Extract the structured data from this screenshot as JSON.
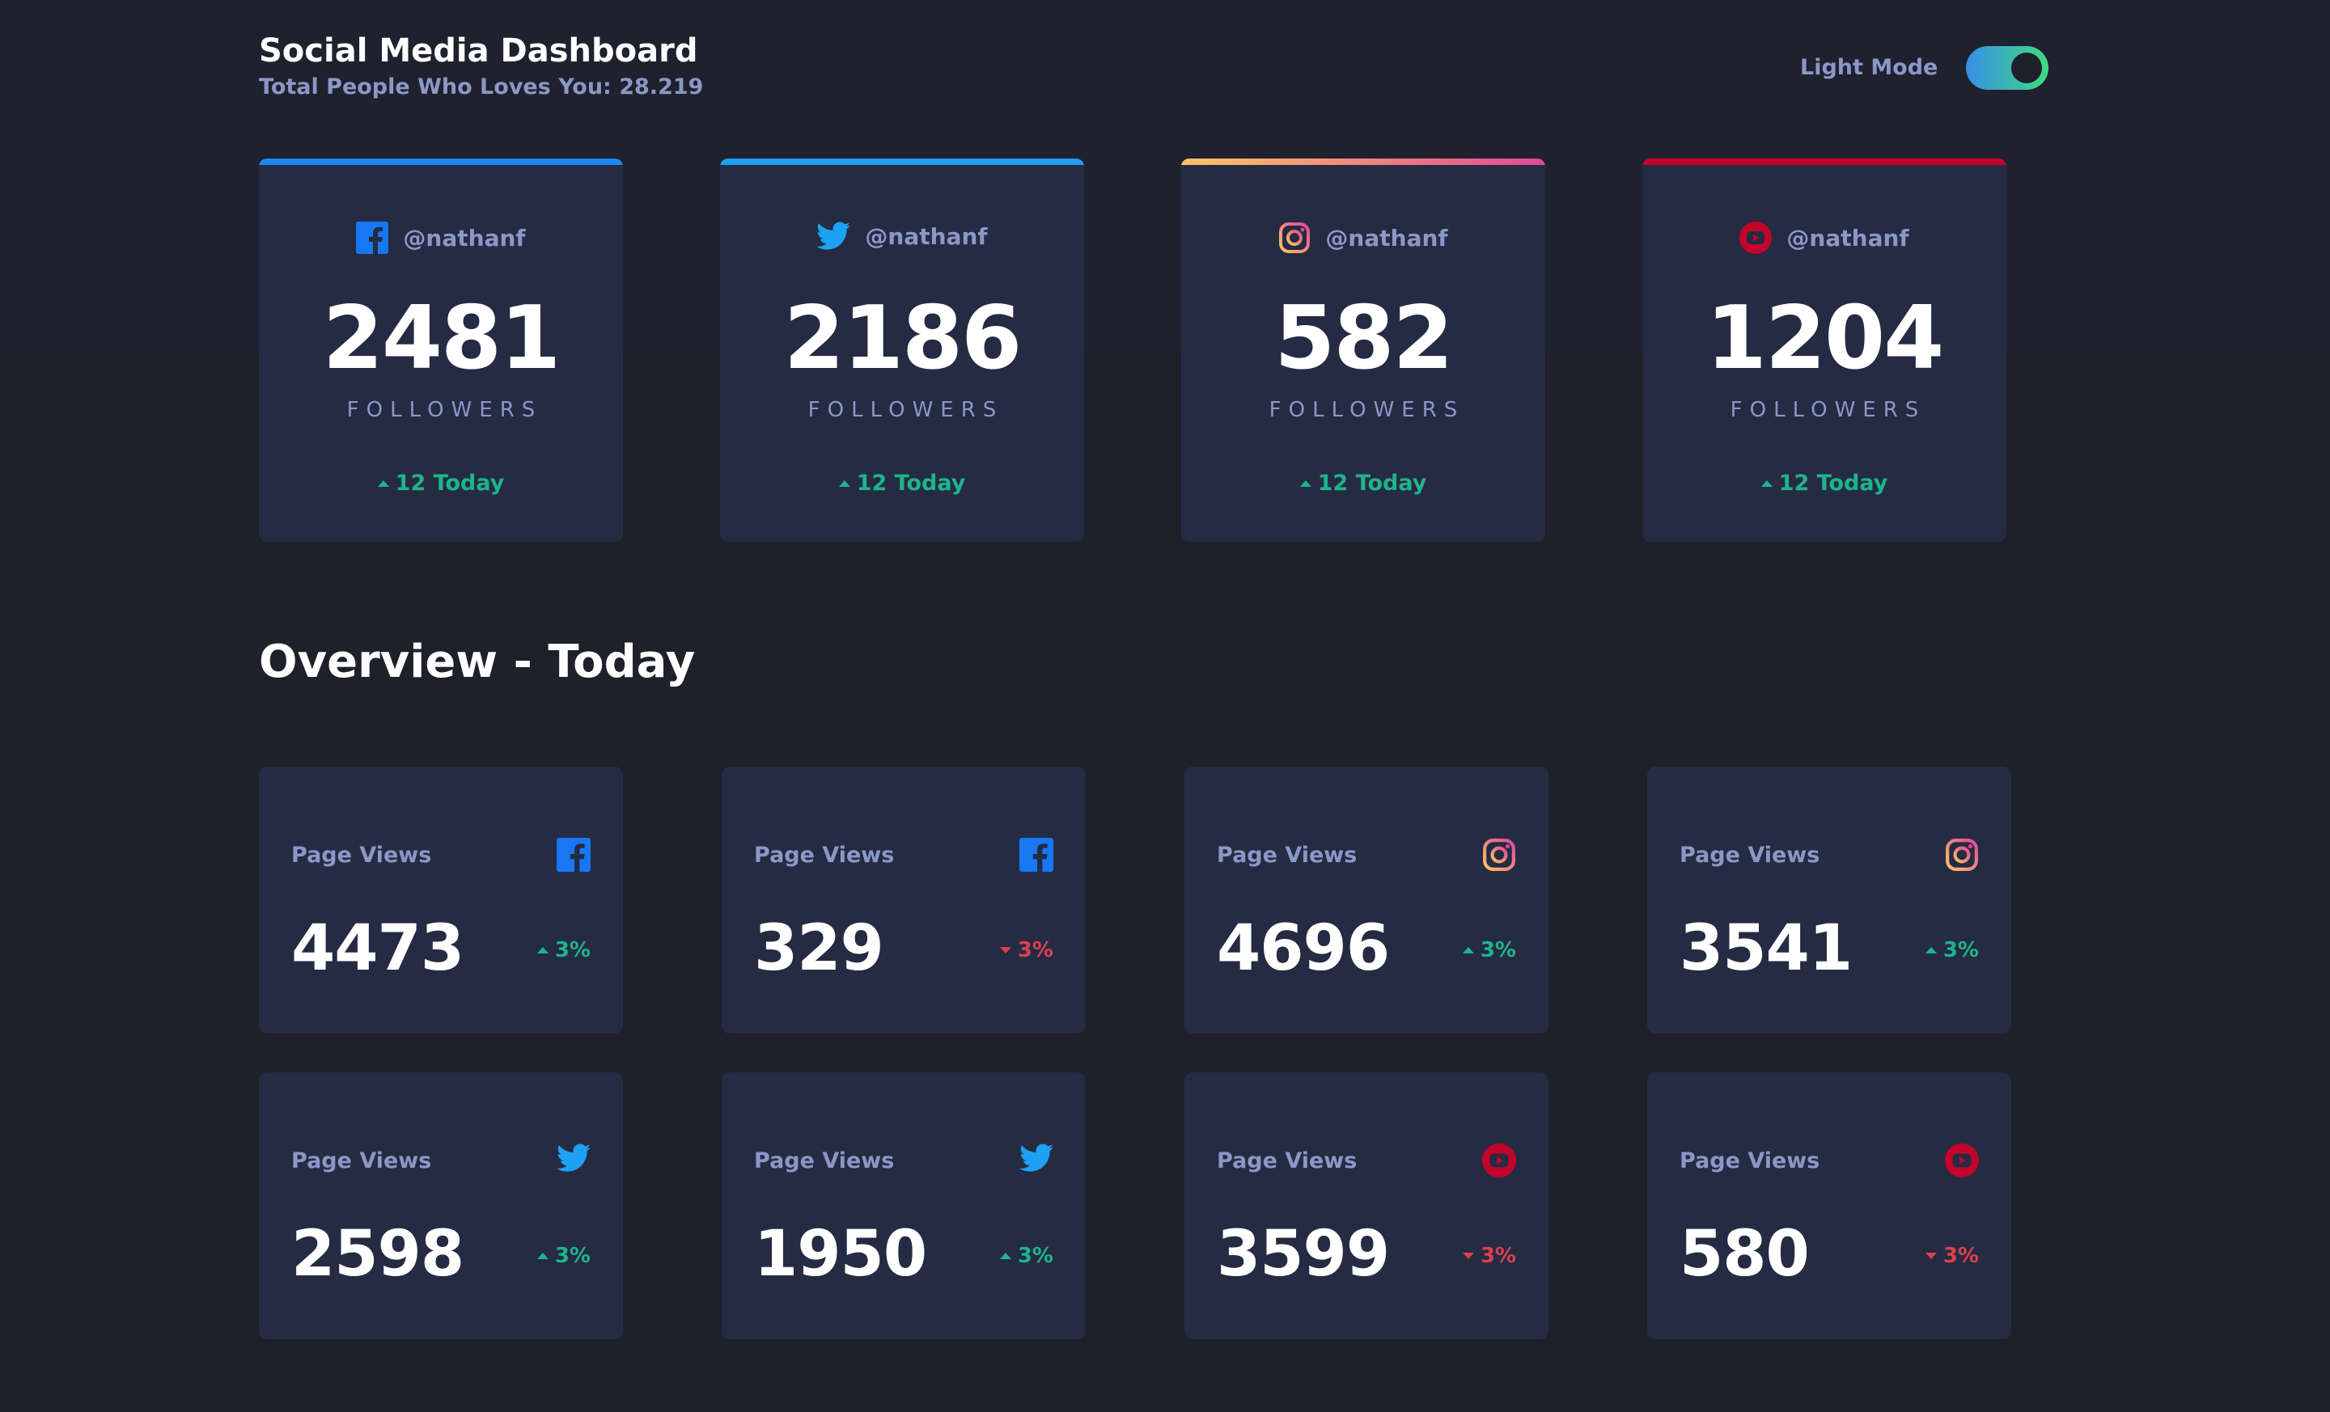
{
  "header": {
    "title": "Social Media Dashboard",
    "subtitle": "Total People Who Loves You: 28.219",
    "mode_label": "Light Mode"
  },
  "colors": {
    "facebook": "#1877f2",
    "twitter": "#1da1f2",
    "instagram": "#f37b6b",
    "youtube": "#c4032a",
    "positive": "#1db489",
    "negative": "#dc414c"
  },
  "followers": [
    {
      "platform": "facebook",
      "icon": "facebook-icon",
      "handle": "@nathanf",
      "count": "2481",
      "label": "FOLLOWERS",
      "today": "12 Today"
    },
    {
      "platform": "twitter",
      "icon": "twitter-icon",
      "handle": "@nathanf",
      "count": "2186",
      "label": "FOLLOWERS",
      "today": "12 Today"
    },
    {
      "platform": "instagram",
      "icon": "instagram-icon",
      "handle": "@nathanf",
      "count": "582",
      "label": "FOLLOWERS",
      "today": "12 Today"
    },
    {
      "platform": "youtube",
      "icon": "youtube-icon",
      "handle": "@nathanf",
      "count": "1204",
      "label": "FOLLOWERS",
      "today": "12 Today"
    }
  ],
  "overview": {
    "title": "Overview - Today",
    "cards": [
      {
        "label": "Page Views",
        "icon": "facebook-icon",
        "value": "4473",
        "change": "3%",
        "direction": "up"
      },
      {
        "label": "Page Views",
        "icon": "facebook-icon",
        "value": "329",
        "change": "3%",
        "direction": "down"
      },
      {
        "label": "Page Views",
        "icon": "instagram-icon",
        "value": "4696",
        "change": "3%",
        "direction": "up"
      },
      {
        "label": "Page Views",
        "icon": "instagram-icon",
        "value": "3541",
        "change": "3%",
        "direction": "up"
      },
      {
        "label": "Page Views",
        "icon": "twitter-icon",
        "value": "2598",
        "change": "3%",
        "direction": "up"
      },
      {
        "label": "Page Views",
        "icon": "twitter-icon",
        "value": "1950",
        "change": "3%",
        "direction": "up"
      },
      {
        "label": "Page Views",
        "icon": "youtube-icon",
        "value": "3599",
        "change": "3%",
        "direction": "down"
      },
      {
        "label": "Page Views",
        "icon": "youtube-icon",
        "value": "580",
        "change": "3%",
        "direction": "down"
      }
    ]
  }
}
